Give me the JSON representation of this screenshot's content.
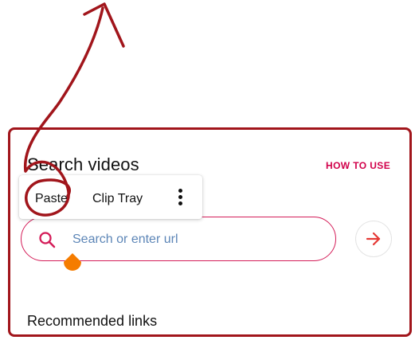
{
  "page": {
    "title": "Search videos",
    "how_to_use": "HOW TO USE",
    "section_heading": "Recommended links"
  },
  "context_menu": {
    "paste": "Paste",
    "clip_tray": "Clip Tray",
    "more_icon": "more-vert-icon"
  },
  "search": {
    "placeholder": "Search or enter url",
    "value": "",
    "icon": "search-icon"
  },
  "go_button": {
    "icon": "arrow-right-icon"
  },
  "colors": {
    "accent": "#d41c58",
    "placeholder": "#5d86b7",
    "cursor_handle": "#f57c00",
    "annotation": "#a1151b"
  }
}
